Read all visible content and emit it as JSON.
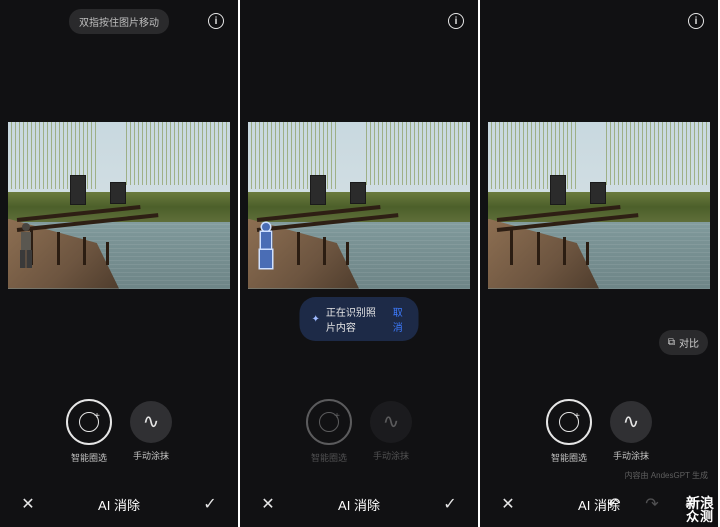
{
  "hint": "双指按住图片移动",
  "toast": {
    "text": "正在识别照片内容",
    "cancel": "取消"
  },
  "compare": "对比",
  "tools": {
    "smart": "智能圈选",
    "manual": "手动涂抹"
  },
  "bottom": {
    "title": "AI 消除",
    "credit": "内容由 AndesGPT 生成"
  },
  "watermark": {
    "brand": "新浪",
    "sub": "众测"
  }
}
